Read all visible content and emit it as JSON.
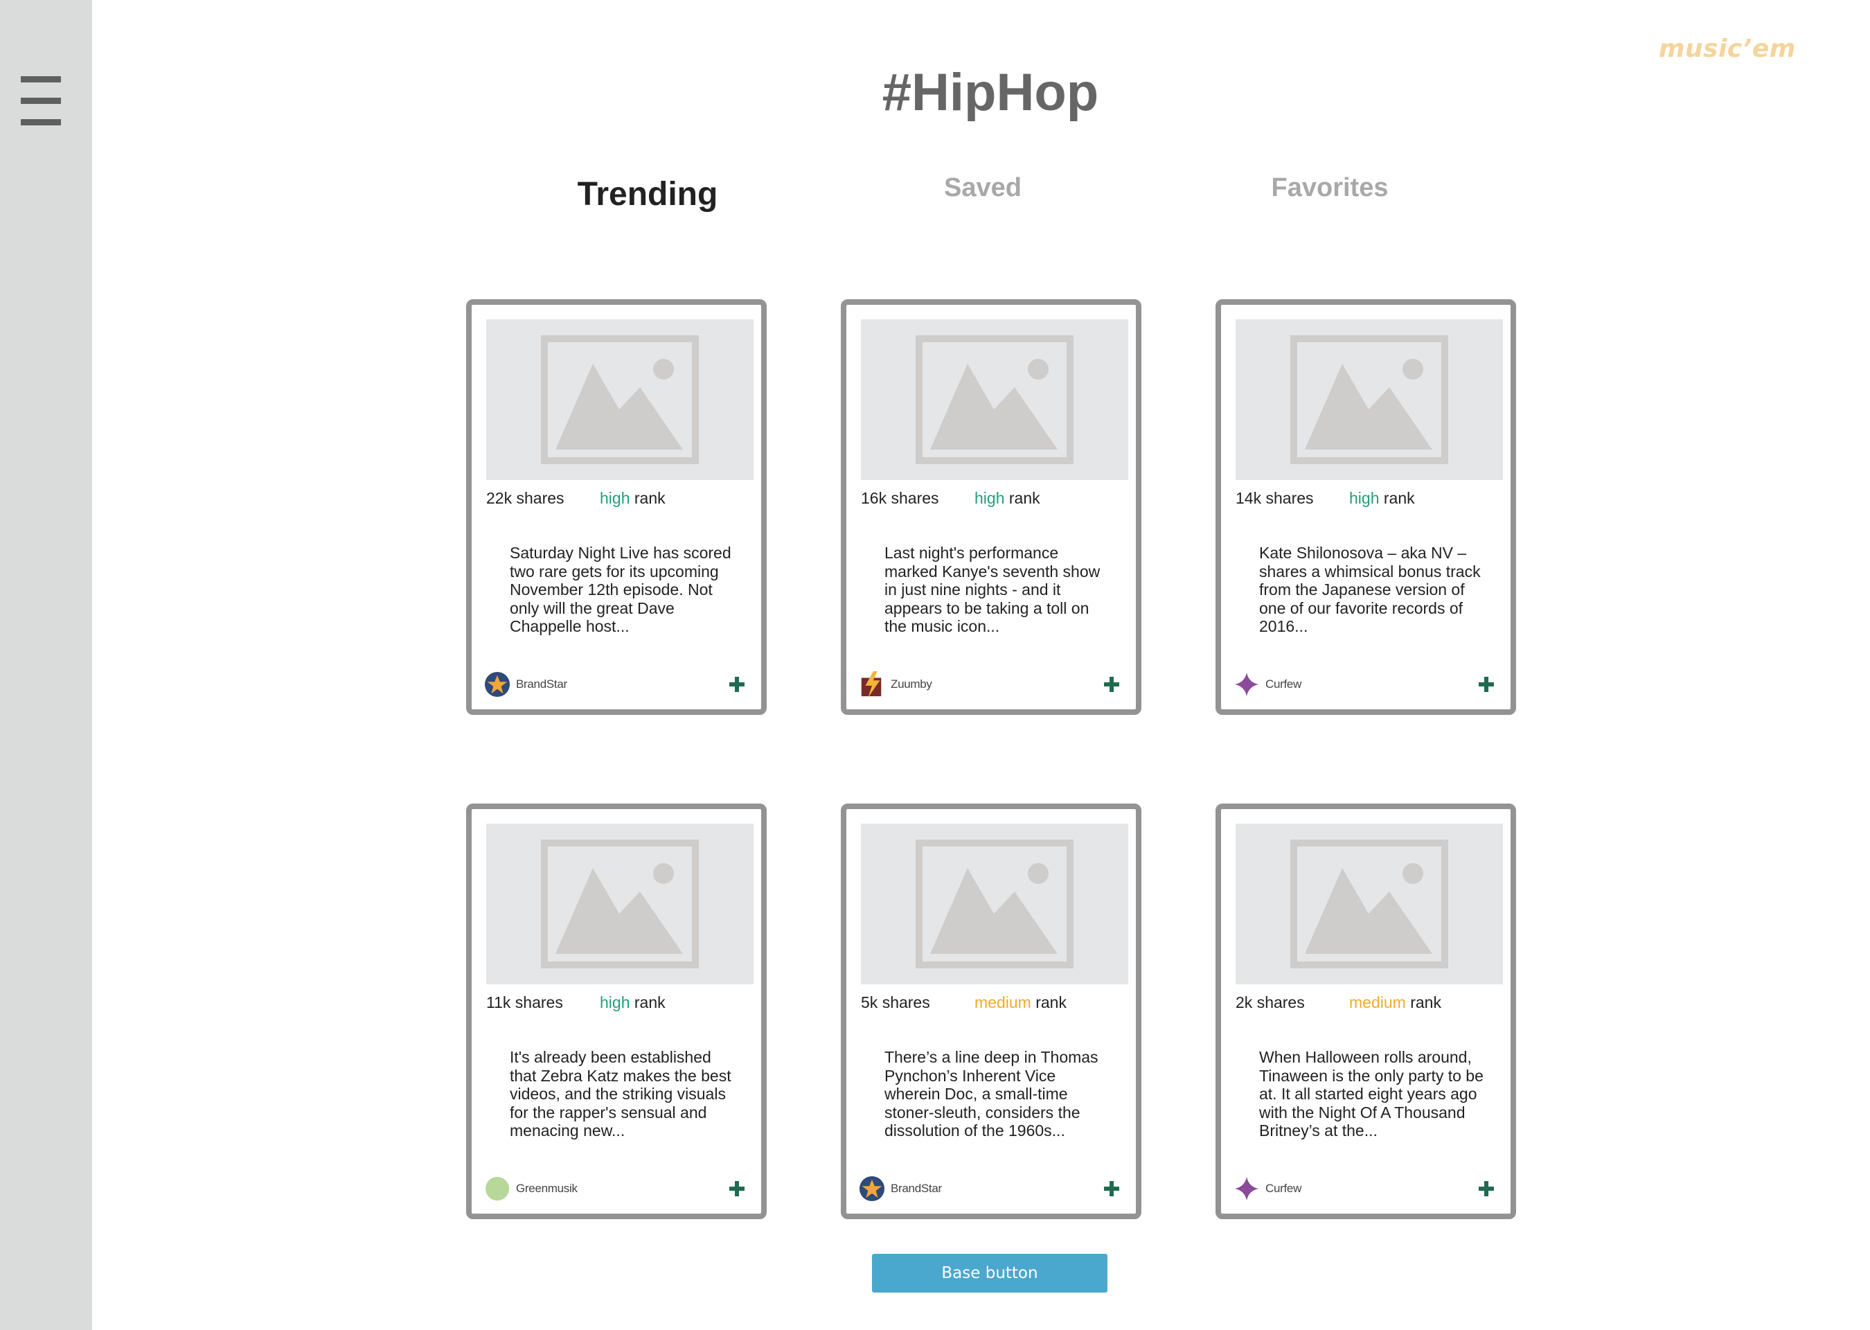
{
  "sidebar": {
    "menu_icon": "hamburger-icon"
  },
  "brand": {
    "name": "music’em",
    "color": "#f6d49a"
  },
  "page_title": "#HipHop",
  "tabs": [
    {
      "label": "Trending",
      "active": true
    },
    {
      "label": "Saved",
      "active": false
    },
    {
      "label": "Favorites",
      "active": false
    }
  ],
  "labels": {
    "shares": "shares",
    "rank": "rank"
  },
  "colors": {
    "high": "#20a07a",
    "medium": "#f0ad2a",
    "add": "#1f6b4e",
    "button": "#4aa8cf"
  },
  "cards": [
    {
      "shares": "22k",
      "rank": "high",
      "excerpt": "Saturday Night Live has scored two rare gets for its upcoming November 12th episode. Not only will the great Dave Chappelle host...",
      "source": "BrandStar",
      "source_icon": "star-circle-icon"
    },
    {
      "shares": "16k",
      "rank": "high",
      "excerpt": "Last night's performance marked Kanye's seventh show in just nine nights - and it appears to be taking a toll on the music icon...",
      "source": "Zuumby",
      "source_icon": "bolt-square-icon"
    },
    {
      "shares": "14k",
      "rank": "high",
      "excerpt": "Kate Shilonosova – aka NV – shares a whimsical bonus track from the Japanese version of one of our favorite records of 2016...",
      "source": "Curfew",
      "source_icon": "four-point-star-icon"
    },
    {
      "shares": "11k",
      "rank": "high",
      "excerpt": "It's already been established that Zebra Katz makes the best videos, and the striking visuals for the rapper's sensual and menacing new...",
      "source": "Greenmusik",
      "source_icon": "green-circle-icon"
    },
    {
      "shares": "5k",
      "rank": "medium",
      "excerpt": "There’s a line deep in Thomas Pynchon’s Inherent Vice wherein Doc, a small-time stoner-sleuth, considers the dissolution of the 1960s...",
      "source": "BrandStar",
      "source_icon": "star-circle-icon"
    },
    {
      "shares": "2k",
      "rank": "medium",
      "excerpt": "When Halloween rolls around, Tinaween is the only party to be at. It all started eight years ago with the Night Of A Thousand Britney’s at the...",
      "source": "Curfew",
      "source_icon": "four-point-star-icon"
    }
  ],
  "base_button": {
    "label": "Base button"
  }
}
